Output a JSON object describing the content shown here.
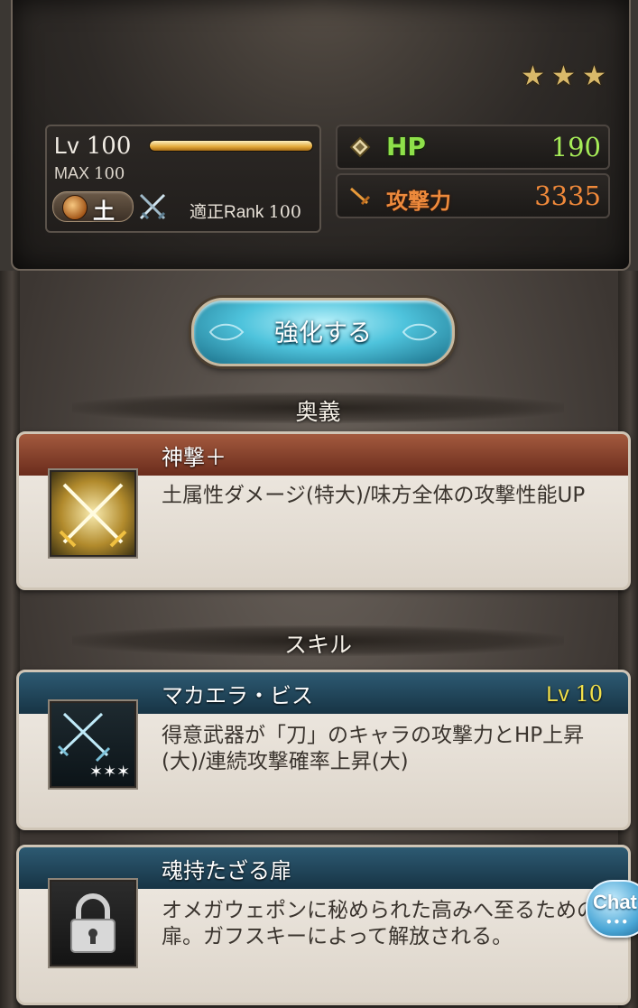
{
  "character": {
    "rarity_stars": 3,
    "level_label": "Lv",
    "level": "100",
    "level_progress": 1.0,
    "max_label": "MAX",
    "max_level": "100",
    "element": "土",
    "rank_label": "適正Rank",
    "rank": "100"
  },
  "stats": {
    "hp_label": "HP",
    "hp_value": "190",
    "atk_label": "攻撃力",
    "atk_value": "3335"
  },
  "actions": {
    "enhance_label": "強化する"
  },
  "sections": {
    "ougi_title": "奥義",
    "skill_title": "スキル"
  },
  "ougi": {
    "name": "神撃＋",
    "description": "土属性ダメージ(特大)/味方全体の攻撃性能UP"
  },
  "skills": [
    {
      "name": "マカエラ・ビス",
      "level_label": "Lv",
      "level": "10",
      "description": "得意武器が「刀」のキャラの攻撃力とHP上昇(大)/連続攻撃確率上昇(大)"
    },
    {
      "name": "魂持たざる扉",
      "description": "オメガウェポンに秘められた高みへ至るための扉。ガフスキーによって解放される。"
    }
  ],
  "chat": {
    "label": "Chat",
    "dots": "•••"
  }
}
